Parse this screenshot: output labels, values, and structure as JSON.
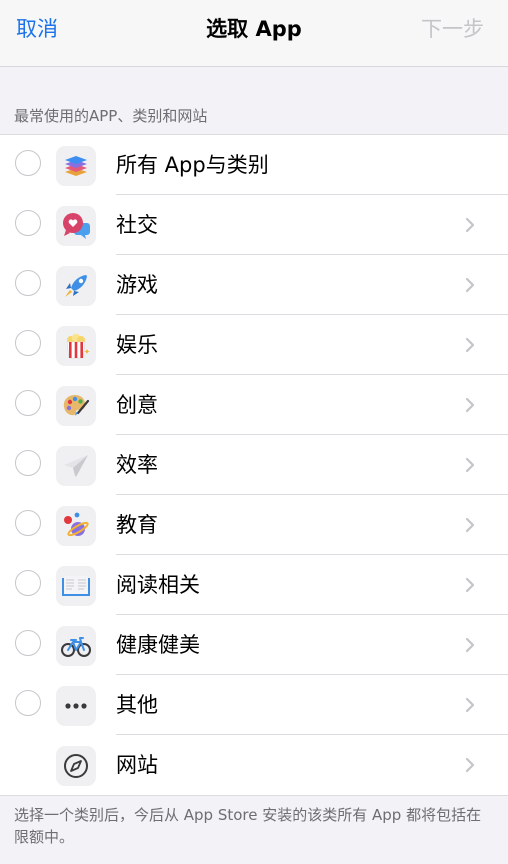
{
  "navbar": {
    "cancel_label": "取消",
    "title": "选取 App",
    "next_label": "下一步"
  },
  "section_header": "最常使用的APP、类别和网站",
  "rows": [
    {
      "label": "所有 App与类别",
      "icon": "stack-icon",
      "has_radio": true,
      "has_chevron": false
    },
    {
      "label": "社交",
      "icon": "chat-bubbles-icon",
      "has_radio": true,
      "has_chevron": true
    },
    {
      "label": "游戏",
      "icon": "rocket-icon",
      "has_radio": true,
      "has_chevron": true
    },
    {
      "label": "娱乐",
      "icon": "popcorn-icon",
      "has_radio": true,
      "has_chevron": true
    },
    {
      "label": "创意",
      "icon": "palette-icon",
      "has_radio": true,
      "has_chevron": true
    },
    {
      "label": "效率",
      "icon": "paper-plane-icon",
      "has_radio": true,
      "has_chevron": true
    },
    {
      "label": "教育",
      "icon": "planet-icon",
      "has_radio": true,
      "has_chevron": true
    },
    {
      "label": "阅读相关",
      "icon": "book-icon",
      "has_radio": true,
      "has_chevron": true
    },
    {
      "label": "健康健美",
      "icon": "bicycle-icon",
      "has_radio": true,
      "has_chevron": true
    },
    {
      "label": "其他",
      "icon": "more-icon",
      "has_radio": true,
      "has_chevron": true
    },
    {
      "label": "网站",
      "icon": "compass-icon",
      "has_radio": false,
      "has_chevron": true
    }
  ],
  "footer_note": "选择一个类别后，今后从 App Store 安装的该类所有 App 都将包括在限额中。",
  "colors": {
    "accent": "#1a73e8",
    "disabled": "#c4c4c9",
    "background": "#f2f2f7"
  }
}
